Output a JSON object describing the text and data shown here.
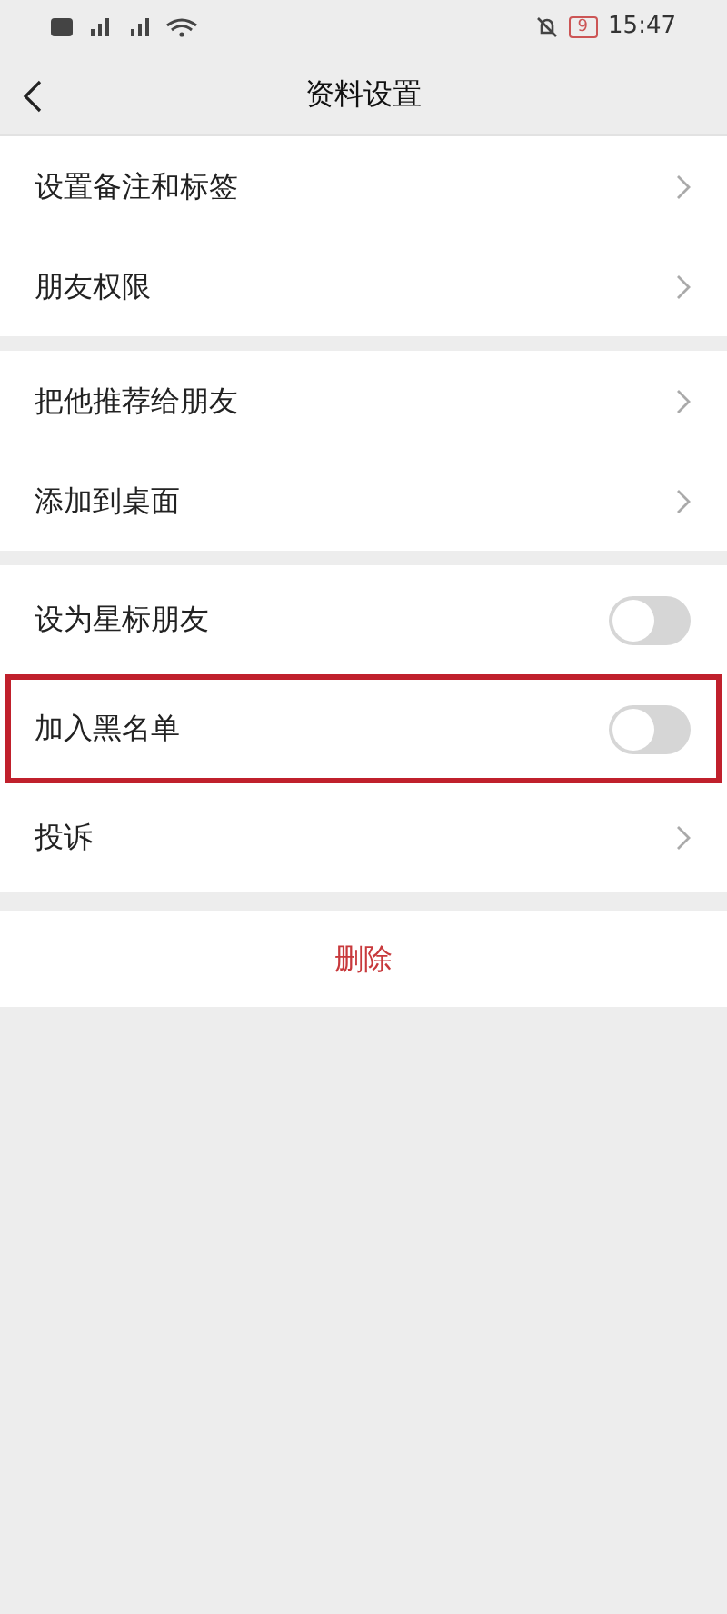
{
  "status_bar": {
    "battery": "9",
    "time": "15:47"
  },
  "nav": {
    "title": "资料设置"
  },
  "groups": [
    {
      "rows": [
        {
          "kind": "link",
          "label": "设置备注和标签",
          "highlighted": false
        },
        {
          "kind": "link",
          "label": "朋友权限",
          "highlighted": false
        }
      ]
    },
    {
      "rows": [
        {
          "kind": "link",
          "label": "把他推荐给朋友",
          "highlighted": false
        },
        {
          "kind": "link",
          "label": "添加到桌面",
          "highlighted": false
        }
      ]
    },
    {
      "rows": [
        {
          "kind": "toggle",
          "label": "设为星标朋友",
          "on": false,
          "highlighted": false
        },
        {
          "kind": "toggle",
          "label": "加入黑名单",
          "on": false,
          "highlighted": true
        },
        {
          "kind": "link",
          "label": "投诉",
          "highlighted": false
        }
      ]
    }
  ],
  "delete_button": "删除"
}
